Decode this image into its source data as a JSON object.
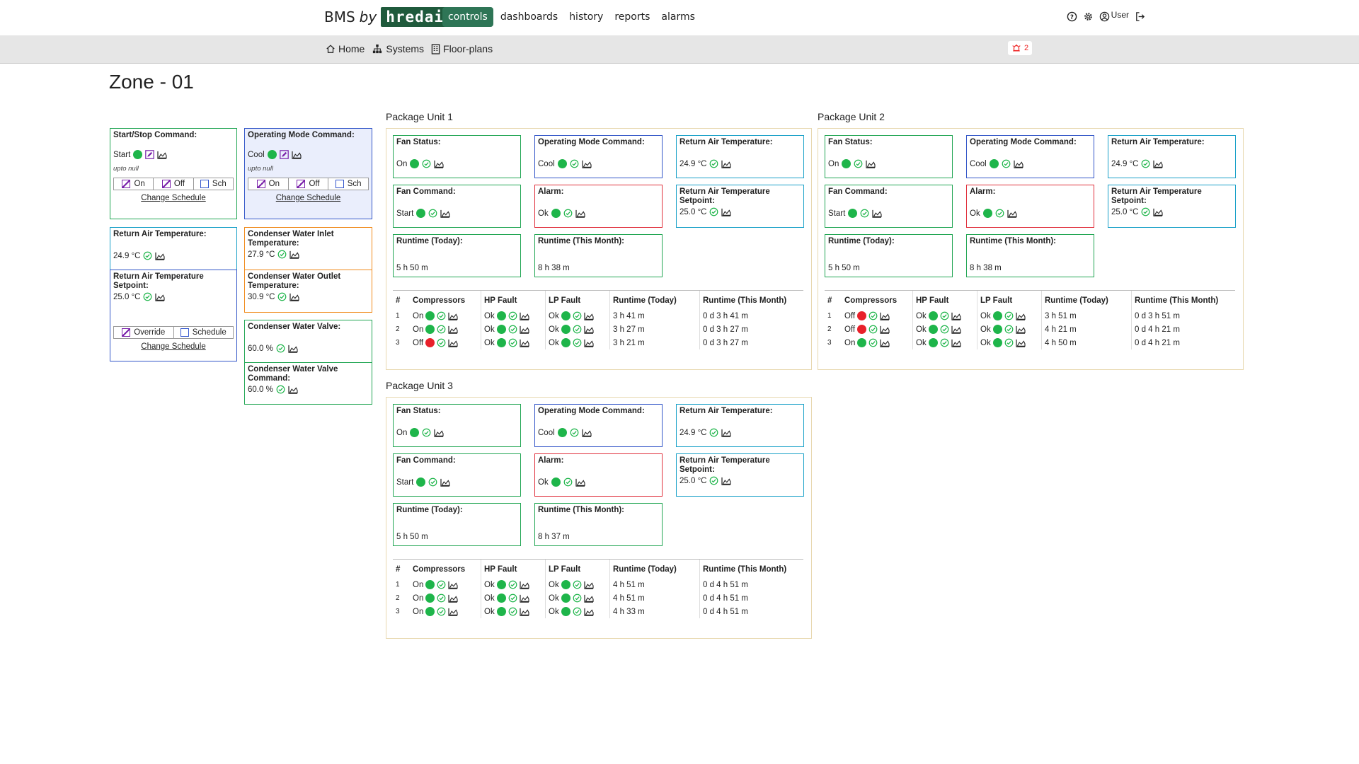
{
  "header": {
    "brand_prefix": "BMS",
    "brand_by": "by",
    "brand_logo": "hredai",
    "nav": [
      {
        "label": "controls",
        "active": true
      },
      {
        "label": "dashboards",
        "active": false
      },
      {
        "label": "history",
        "active": false
      },
      {
        "label": "reports",
        "active": false
      },
      {
        "label": "alarms",
        "active": false
      }
    ],
    "user_label": "User",
    "icons": [
      "help-icon",
      "gear-icon",
      "user-icon",
      "logout-icon"
    ]
  },
  "subnav": {
    "items": [
      {
        "label": "Home",
        "icon": "home-icon"
      },
      {
        "label": "Systems",
        "icon": "sitemap-icon"
      },
      {
        "label": "Floor-plans",
        "icon": "building-icon"
      }
    ],
    "alarm_count": "2"
  },
  "page_title": "Zone - 01",
  "zone": {
    "start_stop": {
      "label": "Start/Stop Command:",
      "value": "Start",
      "note": "upto null",
      "buttons": [
        "On",
        "Off",
        "Sch"
      ],
      "link": "Change Schedule"
    },
    "op_mode": {
      "label": "Operating Mode Command:",
      "value": "Cool",
      "note": "upto null",
      "buttons": [
        "On",
        "Off",
        "Sch"
      ],
      "link": "Change Schedule"
    },
    "rat": {
      "label": "Return Air Temperature:",
      "value": "24.9 °C"
    },
    "rat_sp": {
      "label": "Return Air Temperature Setpoint:",
      "value": "25.0 °C",
      "buttons": [
        "Override",
        "Schedule"
      ],
      "link": "Change Schedule"
    },
    "cw_inlet": {
      "label": "Condenser Water Inlet Temperature:",
      "value": "27.9 °C"
    },
    "cw_outlet": {
      "label": "Condenser Water Outlet Temperature:",
      "value": "30.9 °C"
    },
    "cw_valve": {
      "label": "Condenser Water Valve:",
      "value": "60.0 %"
    },
    "cw_valve_cmd": {
      "label": "Condenser Water Valve Command:",
      "value": "60.0 %"
    }
  },
  "labels": {
    "fan_status": "Fan Status:",
    "op_mode": "Operating Mode Command:",
    "rat": "Return Air Temperature:",
    "fan_cmd": "Fan Command:",
    "alarm": "Alarm:",
    "rat_sp": "Return Air Temperature Setpoint:",
    "rt_today": "Runtime (Today):",
    "rt_month": "Runtime (This Month):"
  },
  "table_headers": [
    "#",
    "Compressors",
    "HP Fault",
    "LP Fault",
    "Runtime (Today)",
    "Runtime (This Month)"
  ],
  "units": [
    {
      "title": "Package Unit 1",
      "fan_status": "On",
      "op_mode": "Cool",
      "rat": "24.9 °C",
      "fan_cmd": "Start",
      "alarm": "Ok",
      "rat_sp": "25.0 °C",
      "rt_today": "5 h 50 m",
      "rt_month": "8 h 38 m",
      "rows": [
        {
          "n": "1",
          "comp": "On",
          "comp_on": true,
          "hp": "Ok",
          "lp": "Ok",
          "today": "3 h 41 m",
          "month": "0 d 3 h 41 m"
        },
        {
          "n": "2",
          "comp": "On",
          "comp_on": true,
          "hp": "Ok",
          "lp": "Ok",
          "today": "3 h 27 m",
          "month": "0 d 3 h 27 m"
        },
        {
          "n": "3",
          "comp": "Off",
          "comp_on": false,
          "hp": "Ok",
          "lp": "Ok",
          "today": "3 h 21 m",
          "month": "0 d 3 h 27 m"
        }
      ]
    },
    {
      "title": "Package Unit 2",
      "fan_status": "On",
      "op_mode": "Cool",
      "rat": "24.9 °C",
      "fan_cmd": "Start",
      "alarm": "Ok",
      "rat_sp": "25.0 °C",
      "rt_today": "5 h 50 m",
      "rt_month": "8 h 38 m",
      "rows": [
        {
          "n": "1",
          "comp": "Off",
          "comp_on": false,
          "hp": "Ok",
          "lp": "Ok",
          "today": "3 h 51 m",
          "month": "0 d 3 h 51 m"
        },
        {
          "n": "2",
          "comp": "Off",
          "comp_on": false,
          "hp": "Ok",
          "lp": "Ok",
          "today": "4 h 21 m",
          "month": "0 d 4 h 21 m"
        },
        {
          "n": "3",
          "comp": "On",
          "comp_on": true,
          "hp": "Ok",
          "lp": "Ok",
          "today": "4 h 50 m",
          "month": "0 d 4 h 21 m"
        }
      ]
    },
    {
      "title": "Package Unit 3",
      "fan_status": "On",
      "op_mode": "Cool",
      "rat": "24.9 °C",
      "fan_cmd": "Start",
      "alarm": "Ok",
      "rat_sp": "25.0 °C",
      "rt_today": "5 h 50 m",
      "rt_month": "8 h 37 m",
      "rows": [
        {
          "n": "1",
          "comp": "On",
          "comp_on": true,
          "hp": "Ok",
          "lp": "Ok",
          "today": "4 h 51 m",
          "month": "0 d 4 h 51 m"
        },
        {
          "n": "2",
          "comp": "On",
          "comp_on": true,
          "hp": "Ok",
          "lp": "Ok",
          "today": "4 h 51 m",
          "month": "0 d 4 h 51 m"
        },
        {
          "n": "3",
          "comp": "On",
          "comp_on": true,
          "hp": "Ok",
          "lp": "Ok",
          "today": "4 h 33 m",
          "month": "0 d 4 h 51 m"
        }
      ]
    }
  ],
  "colors": {
    "ok": "#1eb54a",
    "fault": "#e8202a",
    "brand": "#1f5a3c",
    "active_nav": "#2e7556"
  }
}
